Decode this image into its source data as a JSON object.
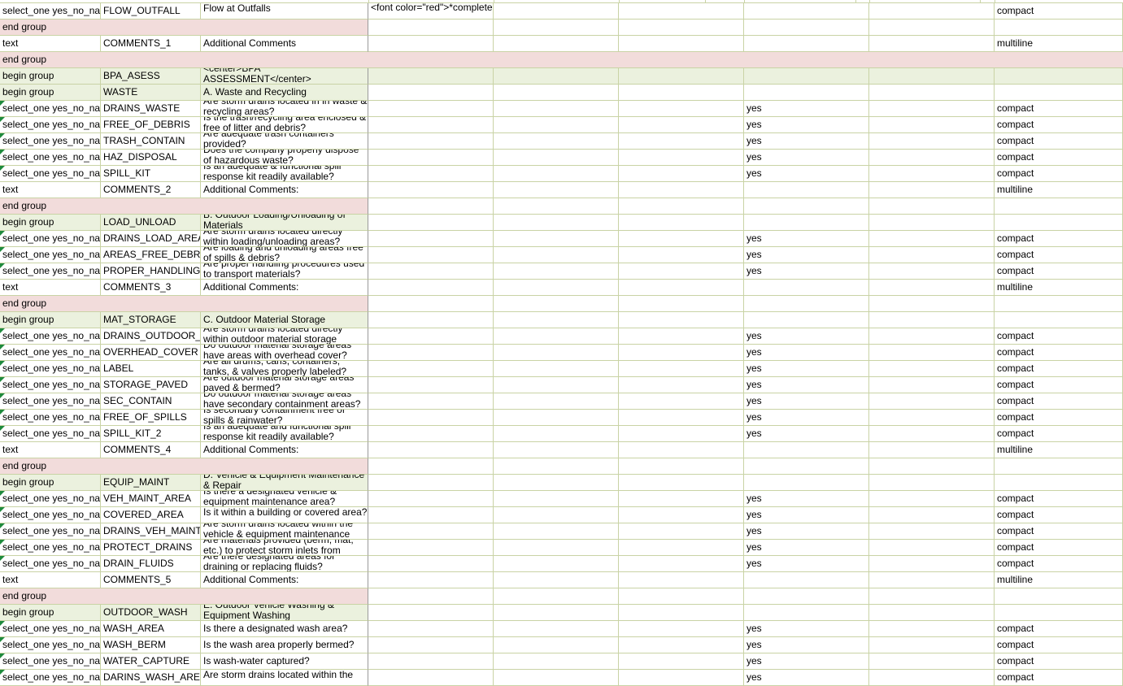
{
  "sheet": {
    "top_partial_text": "<font color=\"red\">*complete",
    "rows": [
      {
        "kind": "q",
        "c0": "select_one yes_no_na",
        "c1": "FLOW_OUTFALL",
        "c2": "Flow at Outfalls",
        "c3": "<font color=\"red\">*complete",
        "c6": "",
        "c8": "compact",
        "tri": false
      },
      {
        "kind": "end"
      },
      {
        "kind": "text",
        "c0": "text",
        "c1": "COMMENTS_1",
        "c2": "Additional Comments",
        "c8": "multiline"
      },
      {
        "kind": "endfull"
      },
      {
        "kind": "beginfull",
        "c0": "begin group",
        "c1": "BPA_ASESS",
        "c2": "<center>BPA ASSESSMENT</center>"
      },
      {
        "kind": "begin",
        "c0": "begin group",
        "c1": "WASTE",
        "c2": "A. Waste and Recycling"
      },
      {
        "kind": "q",
        "c0": "select_one yes_no_na",
        "c1": "DRAINS_WASTE",
        "c2": "Are storm drains located in in waste & recycling areas?",
        "c6": "yes",
        "c8": "compact",
        "tri": true
      },
      {
        "kind": "q",
        "c0": "select_one yes_no_na",
        "c1": "FREE_OF_DEBRIS",
        "c2": "Is the trash/recycling area enclosed & free of litter and debris?",
        "c6": "yes",
        "c8": "compact",
        "tri": true
      },
      {
        "kind": "q",
        "c0": "select_one yes_no_na",
        "c1": "TRASH_CONTAIN",
        "c2": "Are adequate trash containers provided?",
        "c6": "yes",
        "c8": "compact",
        "tri": true
      },
      {
        "kind": "q",
        "c0": "select_one yes_no_na",
        "c1": "HAZ_DISPOSAL",
        "c2": "Does the company properly dispose of hazardous waste?",
        "c6": "yes",
        "c8": "compact",
        "tri": true
      },
      {
        "kind": "q",
        "c0": "select_one yes_no_na",
        "c1": "SPILL_KIT",
        "c2": "Is an adequate & functional spill response kit readily available?",
        "c6": "yes",
        "c8": "compact",
        "tri": true
      },
      {
        "kind": "text",
        "c0": "text",
        "c1": "COMMENTS_2",
        "c2": "Additional Comments:",
        "c8": "multiline"
      },
      {
        "kind": "end"
      },
      {
        "kind": "begin",
        "c0": "begin group",
        "c1": "LOAD_UNLOAD",
        "c2": "B. Outdoor Loading/Unloading of Materials"
      },
      {
        "kind": "q",
        "c0": "select_one yes_no_na",
        "c1": "DRAINS_LOAD_AREA",
        "c2": "Are storm drains located directly within loading/unloading areas?",
        "c6": "yes",
        "c8": "compact",
        "tri": true
      },
      {
        "kind": "q",
        "c0": "select_one yes_no_na",
        "c1": "AREAS_FREE_DEBRIS",
        "c2": "Are loading and unloading areas free of spills & debris?",
        "c6": "yes",
        "c8": "compact",
        "tri": true
      },
      {
        "kind": "q",
        "c0": "select_one yes_no_na",
        "c1": "PROPER_HANDLING",
        "c2": "Are proper handling procedures used to transport materials?",
        "c6": "yes",
        "c8": "compact",
        "tri": true
      },
      {
        "kind": "text",
        "c0": "text",
        "c1": "COMMENTS_3",
        "c2": "Additional Comments:",
        "c8": "multiline"
      },
      {
        "kind": "end"
      },
      {
        "kind": "begin",
        "c0": "begin group",
        "c1": "MAT_STORAGE",
        "c2": "C. Outdoor Material Storage"
      },
      {
        "kind": "q",
        "c0": "select_one yes_no_na",
        "c1": "DRAINS_OUTDOOR_",
        "c2": "Are storm drains located directly within outdoor material storage",
        "c6": "yes",
        "c8": "compact",
        "tri": true
      },
      {
        "kind": "q",
        "c0": "select_one yes_no_na",
        "c1": "OVERHEAD_COVER",
        "c2": "Do outdoor material storage areas have areas with overhead cover?",
        "c6": "yes",
        "c8": "compact",
        "tri": true
      },
      {
        "kind": "q",
        "c0": "select_one yes_no_na",
        "c1": "LABEL",
        "c2": "Are all drums, cans, containers, tanks, & valves properly labeled?",
        "c6": "yes",
        "c8": "compact",
        "tri": true
      },
      {
        "kind": "q",
        "c0": "select_one yes_no_na",
        "c1": "STORAGE_PAVED",
        "c2": "Are outdoor material storage areas paved & bermed?",
        "c6": "yes",
        "c8": "compact",
        "tri": true
      },
      {
        "kind": "q",
        "c0": "select_one yes_no_na",
        "c1": "SEC_CONTAIN",
        "c2": "Do outdoor material storage areas have secondary containment areas?",
        "c6": "yes",
        "c8": "compact",
        "tri": true
      },
      {
        "kind": "q",
        "c0": "select_one yes_no_na",
        "c1": "FREE_OF_SPILLS",
        "c2": "Is secondary containment free of spills & rainwater?",
        "c6": "yes",
        "c8": "compact",
        "tri": true
      },
      {
        "kind": "q",
        "c0": "select_one yes_no_na",
        "c1": "SPILL_KIT_2",
        "c2": "Is an adequate and functional spill response kit readily available?",
        "c6": "yes",
        "c8": "compact",
        "tri": true
      },
      {
        "kind": "text",
        "c0": "text",
        "c1": "COMMENTS_4",
        "c2": "Additional Comments:",
        "c8": "multiline"
      },
      {
        "kind": "end"
      },
      {
        "kind": "begin",
        "c0": "begin group",
        "c1": "EQUIP_MAINT",
        "c2": "D. Vehicle & Equipment Maintenance & Repair"
      },
      {
        "kind": "q",
        "c0": "select_one yes_no_na",
        "c1": "VEH_MAINT_AREA",
        "c2": "Is there a designated vehicle & equipment maintenance area?",
        "c6": "yes",
        "c8": "compact",
        "tri": true
      },
      {
        "kind": "q",
        "c0": "select_one yes_no_na",
        "c1": "COVERED_AREA",
        "c2": "Is it within a building or covered area?",
        "c6": "yes",
        "c8": "compact",
        "tri": true
      },
      {
        "kind": "q",
        "c0": "select_one yes_no_na",
        "c1": "DRAINS_VEH_MAINT",
        "c2": "Are storm drains located within the vehicle & equipment maintenance",
        "c6": "yes",
        "c8": "compact",
        "tri": true
      },
      {
        "kind": "q",
        "c0": "select_one yes_no_na",
        "c1": "PROTECT_DRAINS",
        "c2": "Are materials provided (berm, mat, etc.) to protect storm inlets from",
        "c6": "yes",
        "c8": "compact",
        "tri": true
      },
      {
        "kind": "q",
        "c0": "select_one yes_no_na",
        "c1": "DRAIN_FLUIDS",
        "c2": "Are there designated areas for draining or replacing fluids?",
        "c6": "yes",
        "c8": "compact",
        "tri": true
      },
      {
        "kind": "text",
        "c0": "text",
        "c1": "COMMENTS_5",
        "c2": "Additional Comments:",
        "c8": "multiline"
      },
      {
        "kind": "end"
      },
      {
        "kind": "begin",
        "c0": "begin group",
        "c1": "OUTDOOR_WASH",
        "c2": "E. Outdoor Vehicle Washing & Equipment Washing"
      },
      {
        "kind": "q",
        "c0": "select_one yes_no_na",
        "c1": "WASH_AREA",
        "c2": "Is there a designated wash area?",
        "c6": "yes",
        "c8": "compact",
        "tri": true,
        "single": true
      },
      {
        "kind": "q",
        "c0": "select_one yes_no_na",
        "c1": "WASH_BERM",
        "c2": "Is the wash area properly bermed?",
        "c6": "yes",
        "c8": "compact",
        "tri": true,
        "single": true
      },
      {
        "kind": "q",
        "c0": "select_one yes_no_na",
        "c1": "WATER_CAPTURE",
        "c2": "Is wash-water captured?",
        "c6": "yes",
        "c8": "compact",
        "tri": true,
        "single": true
      },
      {
        "kind": "q",
        "c0": "select_one yes_no_na",
        "c1": "DARINS_WASH_AREA",
        "c2": "Are storm drains located within the",
        "c6": "yes",
        "c8": "compact",
        "tri": true
      }
    ]
  }
}
